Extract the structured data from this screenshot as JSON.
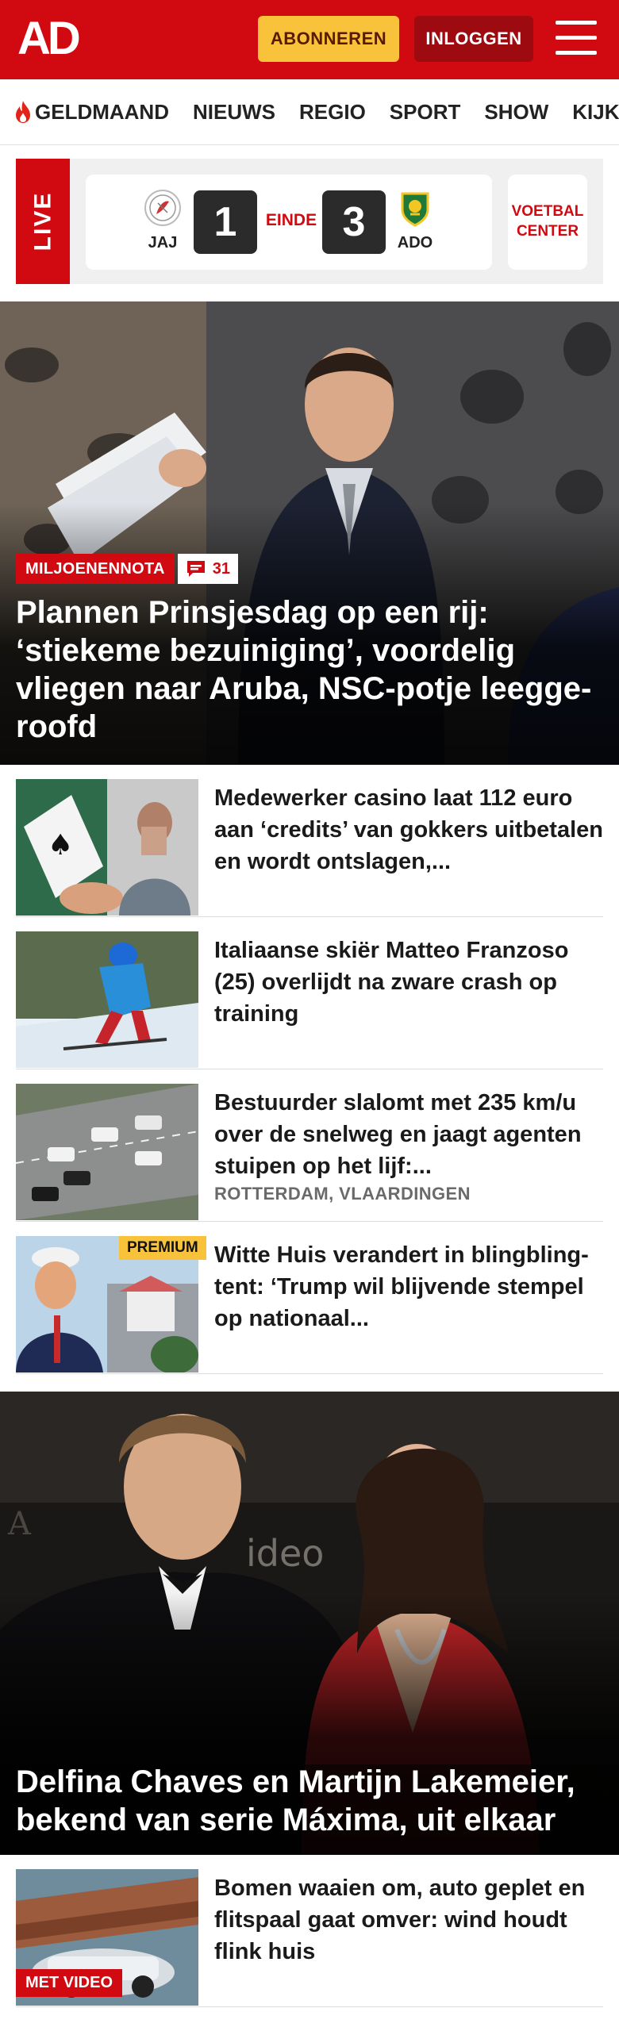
{
  "header": {
    "logo_text": "AD",
    "subscribe_label": "ABONNEREN",
    "login_label": "INLOGGEN",
    "brand_color": "#d10a11"
  },
  "nav": {
    "items": [
      "GELDMAAND",
      "NIEUWS",
      "REGIO",
      "SPORT",
      "SHOW",
      "KIJK"
    ],
    "first_icon": "flame-icon"
  },
  "live": {
    "tag": "LIVE",
    "home_team": "JAJ",
    "home_score": "1",
    "status": "EINDE",
    "away_score": "3",
    "away_team": "ADO",
    "center_line1": "VOETBAL",
    "center_line2": "CENTER"
  },
  "hero": {
    "tag": "MILJOENENNOTA",
    "comments": "31",
    "title": "Plannen Prinsjesdag op een rij: ‘stiekeme bezuiniging’, voordelig vliegen naar Aruba, NSC-potje leegge­roofd"
  },
  "articles": [
    {
      "title": "Medewerker casino laat 112 euro aan ‘credits’ van gokkers uitbetalen en wordt ontslagen,...",
      "meta": "",
      "badge": ""
    },
    {
      "title": "Italiaanse skiër Matteo Franzoso (25) overlijdt na zware crash op training",
      "meta": "",
      "badge": ""
    },
    {
      "title": "Bestuurder slalomt met 235 km/u over de snelweg en jaagt agenten stuipen op het lijf:...",
      "meta": "ROTTERDAM, VLAARDINGEN",
      "badge": ""
    },
    {
      "title": "Witte Huis verandert in blingbling-tent: ‘Trump wil blijvende stempel op nationaal...",
      "meta": "",
      "badge": "PREMIUM"
    }
  ],
  "big_story": {
    "title": "Delfina Chaves en Martijn Lakemeier, bekend van serie Máxima, uit elkaar"
  },
  "articles2": [
    {
      "title": "Bomen waaien om, auto geplet en flitspaal gaat omver: wind houdt flink huis",
      "badge": "MET VIDEO"
    }
  ]
}
